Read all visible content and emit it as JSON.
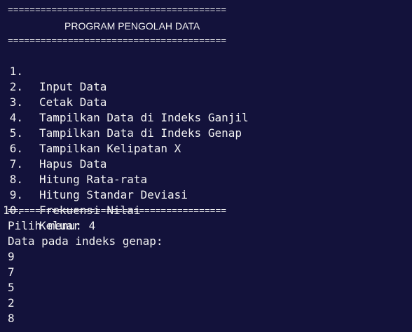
{
  "terminal": {
    "separator": "========================================",
    "title": "PROGRAM PENGOLAH DATA",
    "menu": [
      {
        "num": "1.",
        "label": "Input Data"
      },
      {
        "num": "2.",
        "label": "Cetak Data"
      },
      {
        "num": "3.",
        "label": "Tampilkan Data di Indeks Ganjil"
      },
      {
        "num": "4.",
        "label": "Tampilkan Data di Indeks Genap"
      },
      {
        "num": "5.",
        "label": "Tampilkan Kelipatan X"
      },
      {
        "num": "6.",
        "label": "Hapus Data"
      },
      {
        "num": "7.",
        "label": "Hitung Rata-rata"
      },
      {
        "num": "8.",
        "label": "Hitung Standar Deviasi"
      },
      {
        "num": "9.",
        "label": "Frekuensi Nilai"
      },
      {
        "num": "10.",
        "label": "Keluar"
      }
    ],
    "prompt": "Pilih menu: 4",
    "result_header": "Data pada indeks genap:",
    "values": [
      "9",
      "7",
      "5",
      "2",
      "8"
    ]
  },
  "colors": {
    "background": "#13123b",
    "text": "#f2f2f2"
  }
}
